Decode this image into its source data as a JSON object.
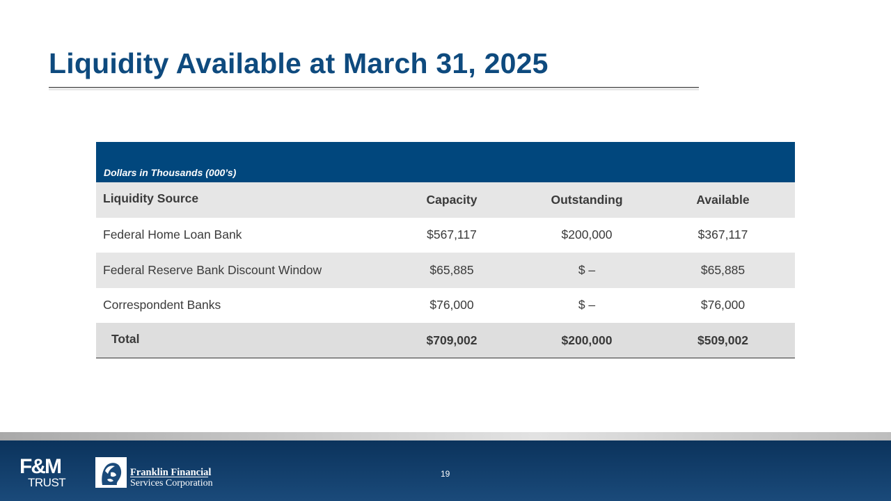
{
  "slide": {
    "title": "Liquidity Available at March 31, 2025",
    "page_number": "19"
  },
  "table": {
    "caption": "Dollars in Thousands (000’s)",
    "headers": [
      "Liquidity Source",
      "Capacity",
      "Outstanding",
      "Available"
    ],
    "rows": [
      {
        "source": "Federal Home Loan Bank",
        "capacity": "$567,117",
        "outstanding": "$200,000",
        "available": "$367,117"
      },
      {
        "source": "Federal Reserve Bank Discount Window",
        "capacity": "$65,885",
        "outstanding": "$ –",
        "available": "$65,885"
      },
      {
        "source": "Correspondent Banks",
        "capacity": "$76,000",
        "outstanding": "$ –",
        "available": "$76,000"
      }
    ],
    "total": {
      "label": "Total",
      "capacity": "$709,002",
      "outstanding": "$200,000",
      "available": "$509,002"
    }
  },
  "footer": {
    "fm_logo_top": "F&M",
    "fm_logo_bottom": "TRUST",
    "company_line1": "Franklin Financial",
    "company_line2": "Services Corporation",
    "emblem_icon": "franklin-portrait-emblem"
  },
  "colors": {
    "title": "#0e4a7e",
    "table_header_band": "#01477d",
    "footer": "#0b335c"
  }
}
